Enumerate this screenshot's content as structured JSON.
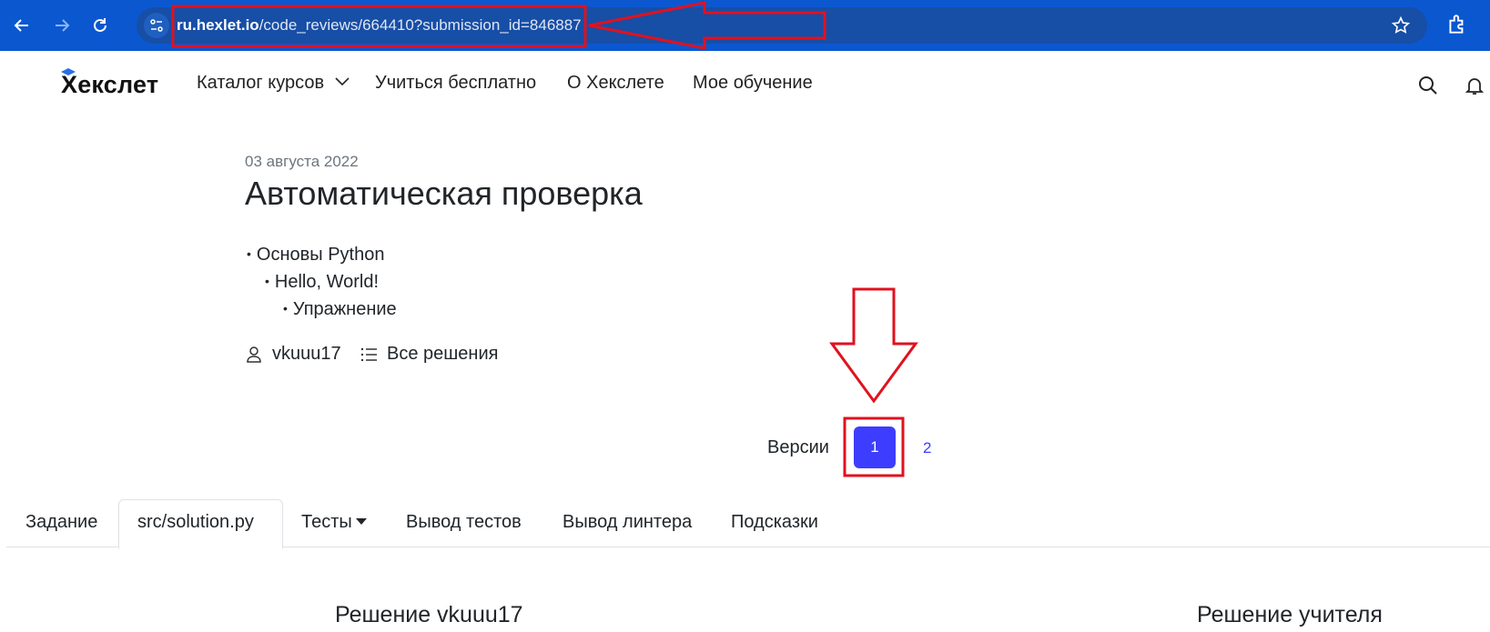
{
  "browser": {
    "url_host": "ru.hexlet.io",
    "url_path": "/code_reviews/664410?submission_id=846887",
    "colors": {
      "chrome": "#0b57d0",
      "omnibox": "#174ea6"
    },
    "icons": [
      "back-arrow-icon",
      "forward-arrow-icon",
      "reload-icon",
      "site-info-icon",
      "star-icon",
      "extensions-icon"
    ]
  },
  "header": {
    "logo": "Хекслет",
    "nav": {
      "catalog": "Каталог курсов",
      "free": "Учиться бесплатно",
      "about": "О Хекслете",
      "my_learning": "Мое обучение"
    },
    "icons": [
      "chevron-down-icon",
      "search-icon",
      "bell-icon"
    ]
  },
  "review": {
    "date": "03 августа 2022",
    "title": "Автоматическая проверка",
    "breadcrumbs": [
      "Основы Python",
      "Hello, World!",
      "Упражнение"
    ],
    "author": "vkuuu17",
    "all_solutions": "Все решения"
  },
  "versions": {
    "label": "Версии",
    "active": "1",
    "other": "2",
    "accent_color": "#3d3dff"
  },
  "tabs": {
    "task": "Задание",
    "solution": "src/solution.py",
    "tests": "Тесты",
    "tests_output": "Вывод тестов",
    "linter_output": "Вывод линтера",
    "hints": "Подсказки"
  },
  "sections": {
    "student_solution": "Решение vkuuu17",
    "teacher_solution": "Решение учителя"
  },
  "annotations": {
    "color": "#e0121f"
  }
}
